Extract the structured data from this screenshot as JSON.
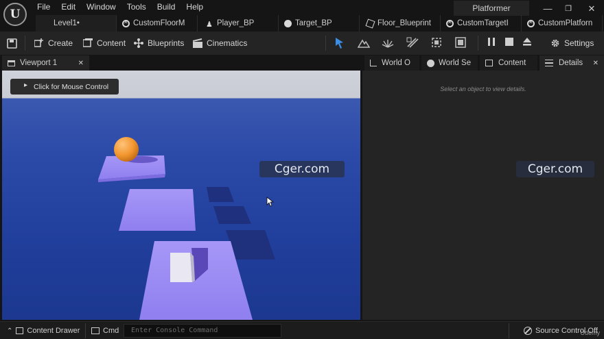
{
  "menu": {
    "items": [
      "File",
      "Edit",
      "Window",
      "Tools",
      "Build",
      "Help"
    ]
  },
  "project_name": "Platformer",
  "window_controls": {
    "minimize": "—",
    "restore": "❐",
    "close": "✕"
  },
  "doc_tabs": [
    {
      "label": "Level1•",
      "icon": "level-icon"
    },
    {
      "label": "CustomFloorM",
      "icon": "blueprint-icon"
    },
    {
      "label": "Player_BP",
      "icon": "pawn-icon"
    },
    {
      "label": "Target_BP",
      "icon": "sphere-icon"
    },
    {
      "label": "Floor_Blueprint",
      "icon": "cube-icon"
    },
    {
      "label": "CustomTargetI",
      "icon": "blueprint-icon"
    },
    {
      "label": "CustomPlatforn",
      "icon": "blueprint-icon"
    }
  ],
  "toolbar": {
    "create": "Create",
    "content": "Content",
    "blueprints": "Blueprints",
    "cinematics": "Cinematics",
    "settings": "Settings"
  },
  "panel_tabs": {
    "viewport": "Viewport 1",
    "world_outliner": "World O",
    "world_settings": "World Se",
    "content": "Content",
    "details": "Details"
  },
  "viewport": {
    "mouse_control": "Click for Mouse Control"
  },
  "details": {
    "hint": "Select an object to view details."
  },
  "watermark": "Cger.com",
  "statusbar": {
    "content_drawer": "Content Drawer",
    "cmd": "Cmd",
    "console_placeholder": "Enter Console Command",
    "source_control": "Source Control Off",
    "corner": "Udemy"
  },
  "colors": {
    "accent_blue": "#3a8ee6",
    "platform": "#9c8cf2",
    "sky_blue": "#2a48a6"
  }
}
